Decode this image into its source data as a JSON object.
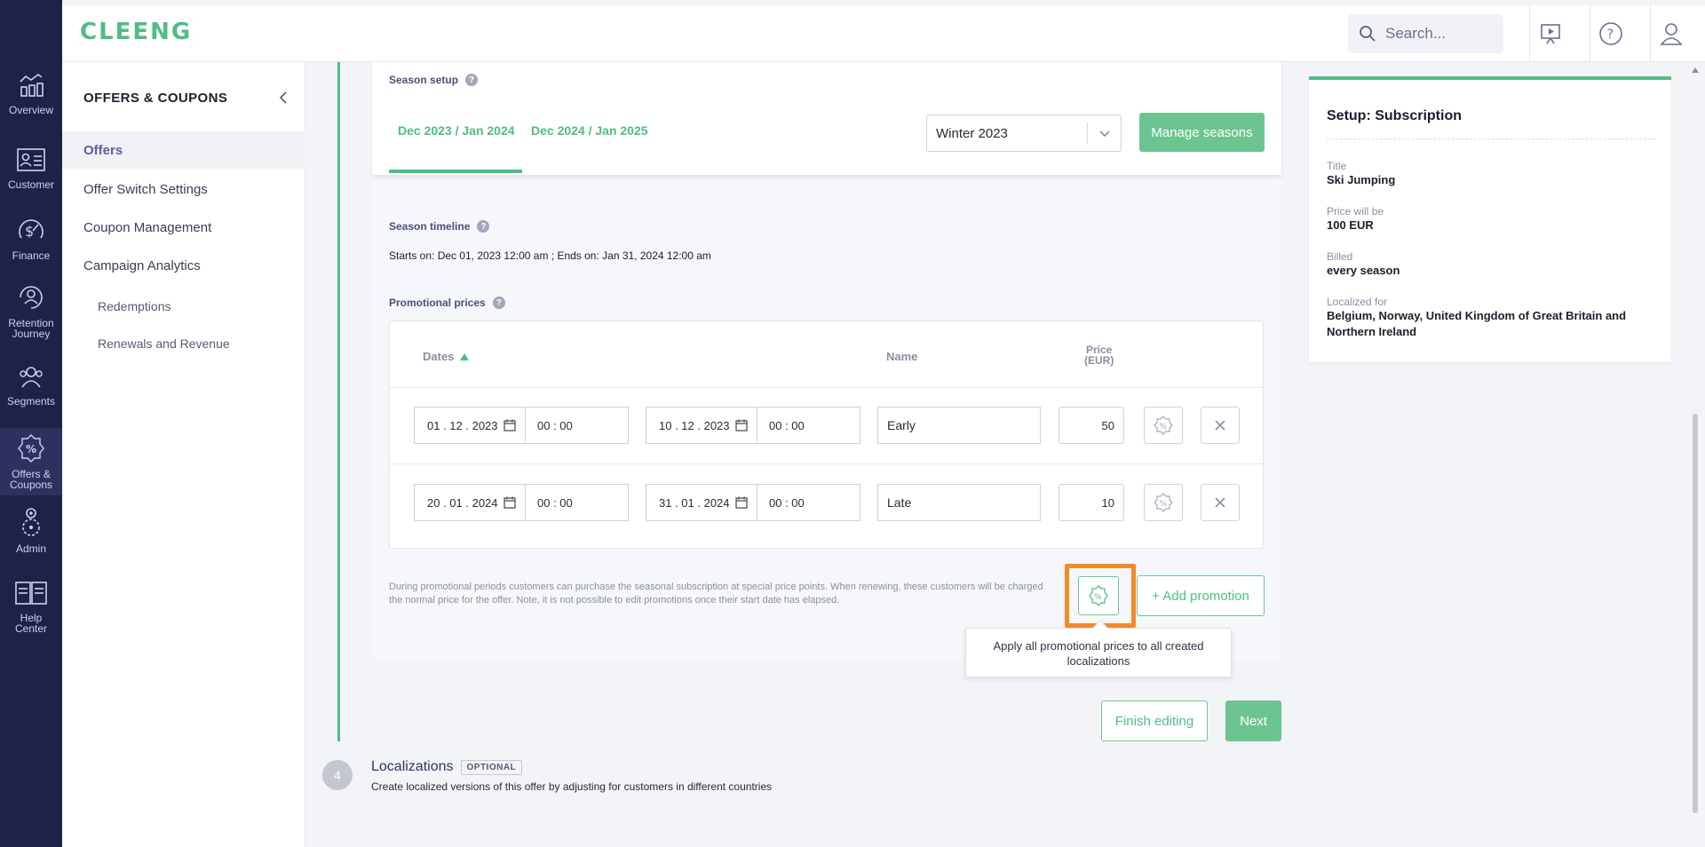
{
  "brand": {
    "logo_text": "CLEENG",
    "accent": "#4fbd84"
  },
  "rail": {
    "items": [
      {
        "label": "Overview",
        "icon": "chart-line-icon"
      },
      {
        "label": "Customer",
        "icon": "id-card-icon"
      },
      {
        "label": "Finance",
        "icon": "dollar-gauge-icon"
      },
      {
        "label": "Retention Journey",
        "icon": "retention-user-icon"
      },
      {
        "label": "Segments",
        "icon": "users-group-icon"
      },
      {
        "label": "Offers & Coupons",
        "icon": "percent-badge-icon"
      },
      {
        "label": "Admin",
        "icon": "admin-gear-icon"
      },
      {
        "label": "Help Center",
        "icon": "book-icon"
      }
    ]
  },
  "topbar": {
    "search_placeholder": "Search..."
  },
  "subnav": {
    "title": "OFFERS & COUPONS",
    "items": [
      {
        "label": "Offers"
      },
      {
        "label": "Offer Switch Settings"
      },
      {
        "label": "Coupon Management"
      },
      {
        "label": "Campaign Analytics"
      }
    ],
    "subitems": [
      {
        "label": "Redemptions"
      },
      {
        "label": "Renewals and Revenue"
      }
    ]
  },
  "season_setup": {
    "label": "Season setup",
    "tabs": [
      {
        "label": "Dec 2023 / Jan 2024"
      },
      {
        "label": "Dec 2024 / Jan 2025"
      }
    ],
    "select_value": "Winter 2023",
    "manage_button": "Manage seasons"
  },
  "season_timeline": {
    "label": "Season timeline",
    "text": "Starts on: Dec 01, 2023 12:00 am ; Ends on: Jan 31, 2024 12:00 am"
  },
  "promotional_prices": {
    "label": "Promotional prices",
    "columns": {
      "dates": "Dates",
      "name": "Name",
      "price_line1": "Price",
      "price_line2": "(EUR)"
    },
    "rows": [
      {
        "start_date": "01 . 12 . 2023",
        "start_time": "00 : 00",
        "end_date": "10 . 12 . 2023",
        "end_time": "00 : 00",
        "name": "Early",
        "price": "50"
      },
      {
        "start_date": "20 . 01 . 2024",
        "start_time": "00 : 00",
        "end_date": "31 . 01 . 2024",
        "end_time": "00 : 00",
        "name": "Late",
        "price": "10"
      }
    ],
    "note": "During promotional periods customers can purchase the seasonal subscription at special price points. When renewing, these customers will be charged the normal price for the offer. Note, it is not possible to edit promotions once their start date has elapsed.",
    "add_button": "+ Add promotion",
    "tooltip": "Apply all promotional prices to all created localizations"
  },
  "actions": {
    "finish_editing": "Finish editing",
    "next": "Next"
  },
  "step4": {
    "number": "4",
    "title": "Localizations",
    "badge": "OPTIONAL",
    "description": "Create localized versions of this offer by adjusting for customers in different countries"
  },
  "summary": {
    "title": "Setup: Subscription",
    "fields": [
      {
        "label": "Title",
        "value": "Ski Jumping"
      },
      {
        "label": "Price will be",
        "value": "100 EUR"
      },
      {
        "label": "Billed",
        "value": "every season"
      },
      {
        "label": "Localized for",
        "value": "Belgium, Norway, United Kingdom of Great Britain and Northern Ireland"
      }
    ]
  }
}
